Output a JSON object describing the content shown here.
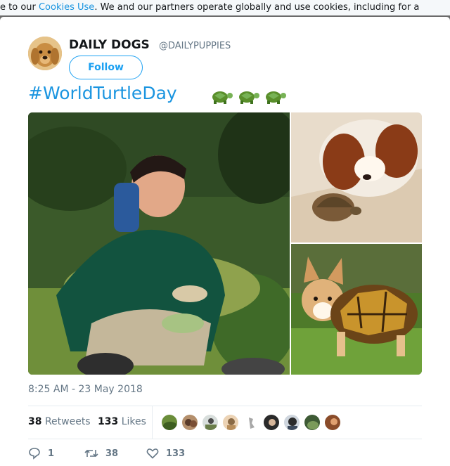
{
  "cookie_banner": {
    "text_before": "e to our ",
    "link": "Cookies Use",
    "text_after": ". We and our partners operate globally and use cookies, including for a"
  },
  "tweet": {
    "display_name": "DAILY DOGS",
    "handle": "@DAILYPUPPIES",
    "follow_label": "Follow",
    "hashtag": "#WorldTurtleDay",
    "emoji": [
      "🐢",
      "🐢",
      "🐢"
    ],
    "timestamp": "8:25 AM - 23 May 2018",
    "retweets_count": "38",
    "retweets_label": "Retweets",
    "likes_count": "133",
    "likes_label": "Likes",
    "actions": {
      "reply_count": "1",
      "retweet_count": "38",
      "like_count": "133"
    }
  },
  "colors": {
    "accent": "#1da1f2",
    "link": "#1b95e0",
    "muted": "#657786",
    "text": "#14171a"
  }
}
